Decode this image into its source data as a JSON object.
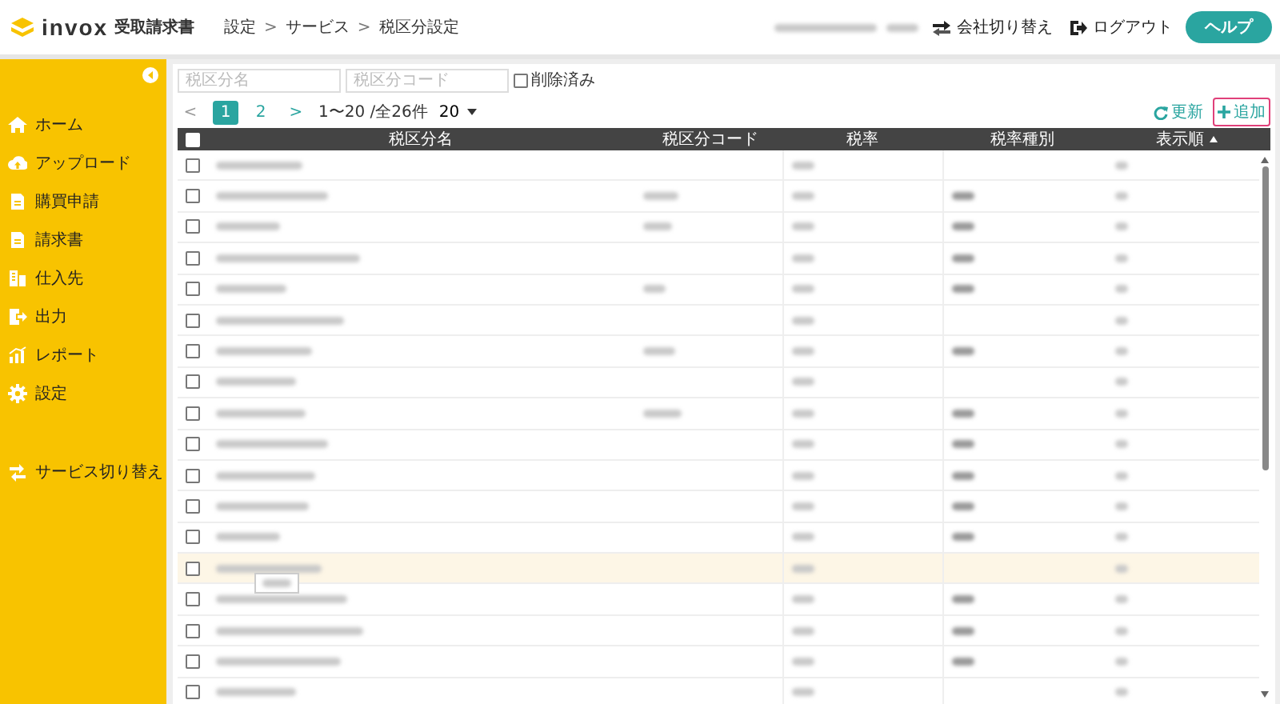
{
  "header": {
    "brand": "invox",
    "product": "受取請求書",
    "breadcrumb": [
      "設定",
      "サービス",
      "税区分設定"
    ],
    "breadcrumb_separator": ">",
    "account_redacted": true,
    "actions": [
      {
        "kind": "switch",
        "label": "会社切り替え"
      },
      {
        "kind": "logout",
        "label": "ログアウト"
      }
    ],
    "help": "ヘルプ"
  },
  "sidebar": {
    "items": [
      {
        "kind": "home",
        "label": "ホーム"
      },
      {
        "kind": "upload",
        "label": "アップロード"
      },
      {
        "kind": "purchase",
        "label": "購買申請"
      },
      {
        "kind": "invoice",
        "label": "請求書"
      },
      {
        "kind": "supplier",
        "label": "仕入先"
      },
      {
        "kind": "export",
        "label": "出力"
      },
      {
        "kind": "report",
        "label": "レポート"
      },
      {
        "kind": "settings",
        "label": "設定"
      },
      {
        "kind": "switch",
        "label": "サービス切り替え"
      }
    ]
  },
  "filters": {
    "name_placeholder": "税区分名",
    "code_placeholder": "税区分コード",
    "deleted_label": "削除済み",
    "deleted_checked": false
  },
  "pager": {
    "prev": "<",
    "pages": [
      {
        "label": "1",
        "selected": true
      },
      {
        "label": "2",
        "selected": false
      }
    ],
    "next": ">",
    "summary": "1〜20 /全26件",
    "per_page": "20"
  },
  "toolbar": {
    "refresh": "更新",
    "add": "追加",
    "add_highlighted": true
  },
  "table": {
    "columns": [
      {
        "label": "税区分名",
        "sorted": false
      },
      {
        "label": "税区分コード",
        "sorted": false
      },
      {
        "label": "税率",
        "sorted": false
      },
      {
        "label": "税率種別",
        "sorted": false
      },
      {
        "label": "表示順",
        "sorted": true
      }
    ],
    "rows": [
      {
        "checked": false,
        "hovered": false,
        "redacted": [
          true,
          false,
          true,
          false,
          true
        ]
      },
      {
        "checked": false,
        "hovered": false,
        "redacted": [
          true,
          true,
          true,
          true,
          true
        ]
      },
      {
        "checked": false,
        "hovered": false,
        "redacted": [
          true,
          true,
          true,
          true,
          true
        ]
      },
      {
        "checked": false,
        "hovered": false,
        "redacted": [
          true,
          false,
          true,
          true,
          true
        ]
      },
      {
        "checked": false,
        "hovered": false,
        "redacted": [
          true,
          true,
          true,
          true,
          true
        ]
      },
      {
        "checked": false,
        "hovered": false,
        "redacted": [
          true,
          false,
          true,
          false,
          true
        ]
      },
      {
        "checked": false,
        "hovered": false,
        "redacted": [
          true,
          true,
          true,
          true,
          true
        ]
      },
      {
        "checked": false,
        "hovered": false,
        "redacted": [
          true,
          false,
          true,
          false,
          true
        ]
      },
      {
        "checked": false,
        "hovered": false,
        "redacted": [
          true,
          true,
          true,
          true,
          true
        ]
      },
      {
        "checked": false,
        "hovered": false,
        "redacted": [
          true,
          false,
          true,
          true,
          true
        ]
      },
      {
        "checked": false,
        "hovered": false,
        "redacted": [
          true,
          false,
          true,
          true,
          true
        ]
      },
      {
        "checked": false,
        "hovered": false,
        "redacted": [
          true,
          false,
          true,
          true,
          true
        ]
      },
      {
        "checked": false,
        "hovered": false,
        "redacted": [
          true,
          false,
          true,
          true,
          true
        ]
      },
      {
        "checked": false,
        "hovered": true,
        "tooltip": true,
        "redacted": [
          true,
          false,
          true,
          false,
          true
        ]
      },
      {
        "checked": false,
        "hovered": false,
        "redacted": [
          true,
          false,
          true,
          true,
          true
        ]
      },
      {
        "checked": false,
        "hovered": false,
        "redacted": [
          true,
          false,
          true,
          true,
          true
        ]
      },
      {
        "checked": false,
        "hovered": false,
        "redacted": [
          true,
          false,
          true,
          true,
          true
        ]
      },
      {
        "checked": false,
        "hovered": false,
        "redacted": [
          true,
          false,
          true,
          false,
          true
        ]
      }
    ],
    "all_checked": false
  }
}
